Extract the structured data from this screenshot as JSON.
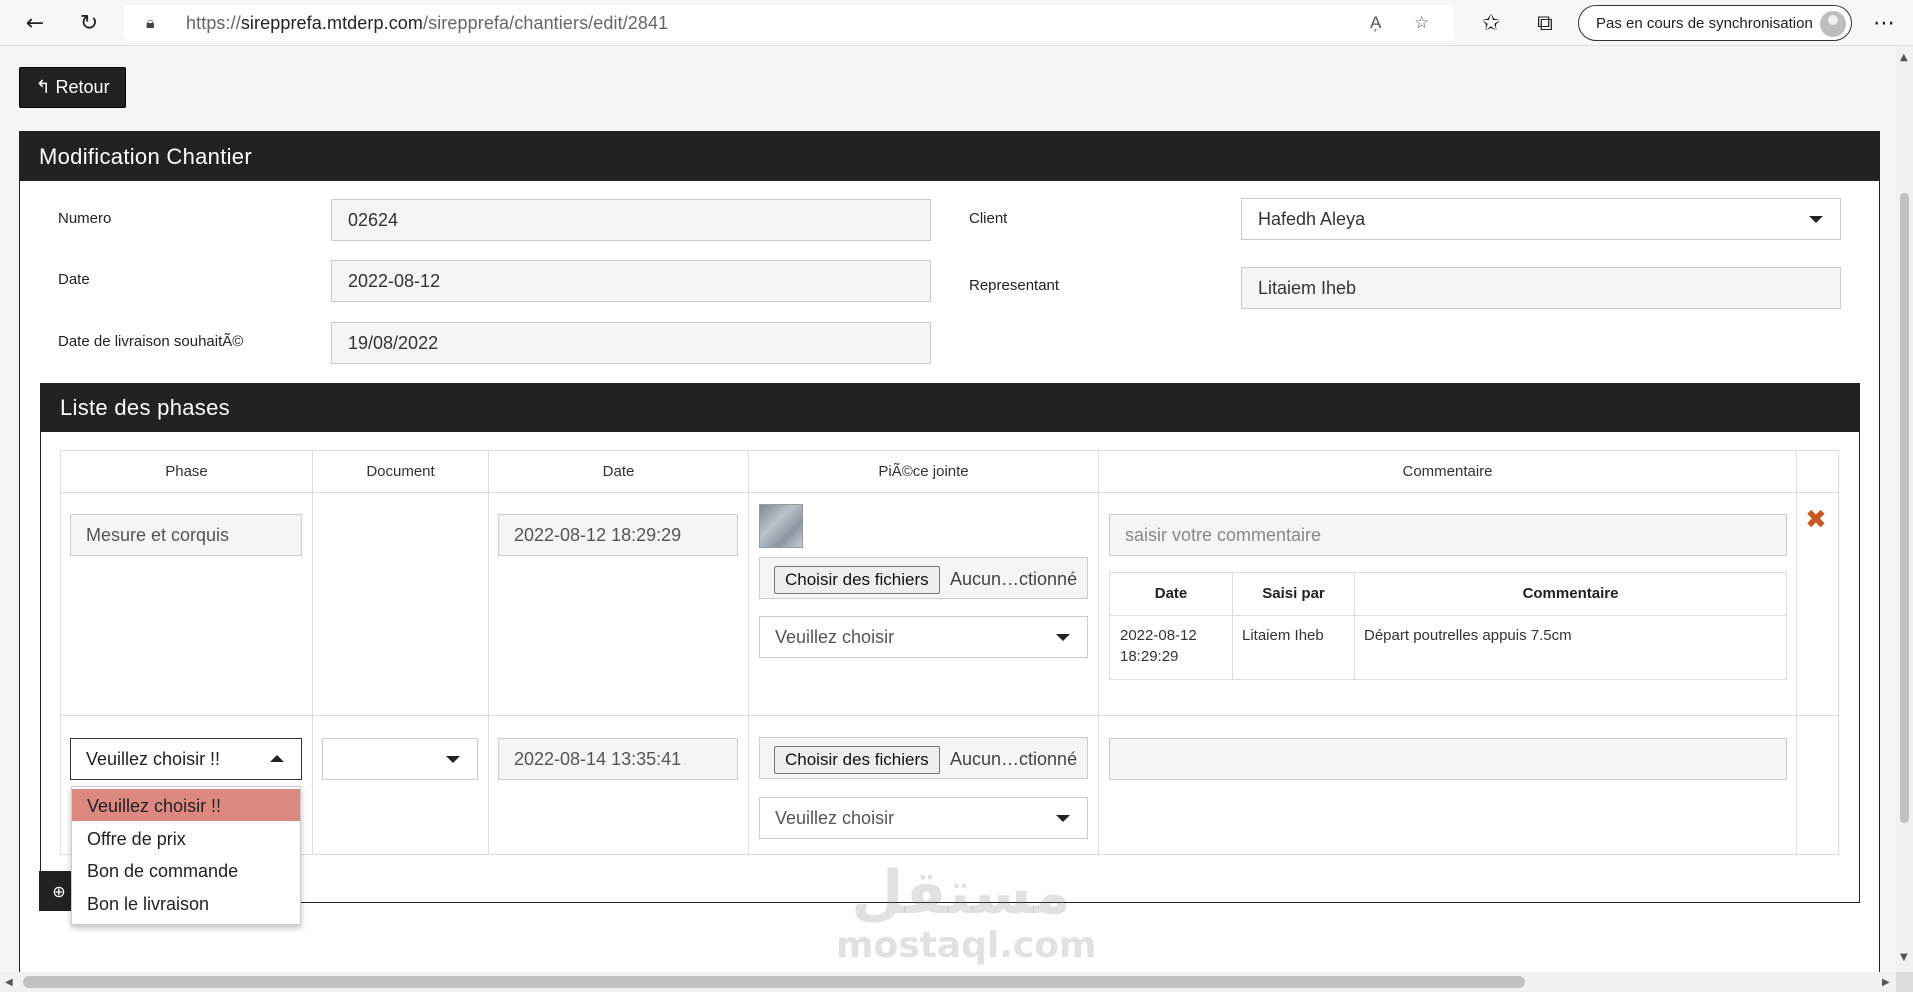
{
  "browser": {
    "url_prefix": "https://",
    "url_host": "sirepprefa.mtderp.com",
    "url_path": "/sirepprefa/chantiers/edit/2841",
    "sync_label": "Pas en cours de synchronisation"
  },
  "page": {
    "back_label": "Retour",
    "title": "Modification Chantier"
  },
  "form": {
    "numero_label": "Numero",
    "numero_value": "02624",
    "date_label": "Date",
    "date_value": "2022-08-12",
    "livraison_label": "Date de livraison souhaitÃ©",
    "livraison_value": "19/08/2022",
    "client_label": "Client",
    "client_value": "Hafedh Aleya",
    "representant_label": "Representant",
    "representant_value": "Litaiem Iheb"
  },
  "phases": {
    "title": "Liste des phases",
    "columns": [
      "Phase",
      "Document",
      "Date",
      "PiÃ©ce jointe",
      "Commentaire"
    ],
    "rows": [
      {
        "phase": "Mesure et corquis",
        "date": "2022-08-12 18:29:29",
        "file_button": "Choisir des fichiers",
        "file_status": "Aucun…ctionné",
        "attachment_select": "Veuillez choisir",
        "comment_placeholder": "saisir votre commentaire",
        "comments_table": {
          "headers": [
            "Date",
            "Saisi par",
            "Commentaire"
          ],
          "rows": [
            {
              "date_line1": "2022-08-12",
              "date_line2": "18:29:29",
              "by": "Litaiem Iheb",
              "text": "Départ poutrelles appuis 7.5cm"
            }
          ]
        }
      },
      {
        "phase_select": "Veuillez choisir !!",
        "document_select": "",
        "date": "2022-08-14 13:35:41",
        "file_button": "Choisir des fichiers",
        "file_status": "Aucun…ctionné",
        "attachment_select": "Veuillez choisir",
        "comment": ""
      }
    ],
    "dropdown_options": [
      "Veuillez choisir !!",
      "Offre de prix",
      "Bon de commande",
      "Bon le livraison"
    ]
  },
  "watermark": {
    "arabic": "مستقل",
    "latin": "mostaql.com"
  },
  "colors": {
    "header_bg": "#222222",
    "selected_option": "#dc8880",
    "delete_icon": "#c75a20"
  }
}
